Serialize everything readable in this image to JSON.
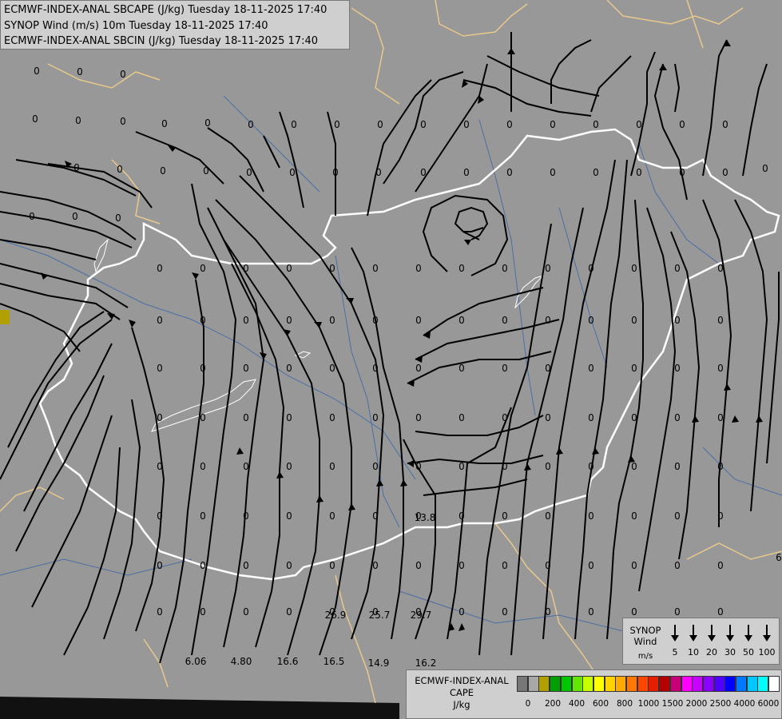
{
  "title_lines": [
    "ECMWF-INDEX-ANAL SBCAPE (J/kg) Tuesday 18-11-2025 17:40",
    "SYNOP Wind (m/s) 10m Tuesday 18-11-2025 17:40",
    "ECMWF-INDEX-ANAL SBCIN (J/kg) Tuesday 18-11-2025 17:40"
  ],
  "synop_legend": {
    "title": "SYNOP\nWind",
    "unit": "m/s",
    "speeds": [
      "5",
      "10",
      "20",
      "30",
      "50",
      "100"
    ]
  },
  "cape_legend": {
    "title": "ECMWF-INDEX-ANAL\nCAPE",
    "unit": "J/kg",
    "colors": [
      "#777777",
      "#a8a8a8",
      "#b0a000",
      "#00a000",
      "#00c800",
      "#64e600",
      "#c8ff00",
      "#ffff00",
      "#ffd200",
      "#ffaa00",
      "#ff7800",
      "#ff4600",
      "#e61e00",
      "#b40000",
      "#c80078",
      "#ff00ff",
      "#c800ff",
      "#8c00ff",
      "#5000ff",
      "#0000ff",
      "#0078ff",
      "#00c8ff",
      "#00ffff",
      "#ffffff"
    ],
    "ticks": [
      "0",
      "200",
      "400",
      "600",
      "800",
      "1000",
      "1500",
      "2000",
      "2500",
      "4000",
      "6000"
    ]
  },
  "values": [
    "0",
    "0",
    "0",
    "0",
    "0",
    "0",
    "0",
    "0",
    "0",
    "0",
    "0",
    "0",
    "0",
    "0",
    "0",
    "0",
    "0",
    "0",
    "0",
    "0",
    "0",
    "0",
    "0",
    "0",
    "0",
    "0",
    "0",
    "0",
    "0",
    "0",
    "0",
    "0",
    "0",
    "0",
    "0",
    "0",
    "0",
    "0",
    "0",
    "0",
    "13.8",
    "26.9",
    "25.7",
    "29.7",
    "6.06",
    "4.80",
    "16.6",
    "16.5",
    "14.9",
    "16.2",
    "6"
  ],
  "map": {
    "background_color": "#989898",
    "border_color": "#ffffff",
    "outer_border_color": "#e8c88c",
    "river_color": "#4a6fa5",
    "streamline_color": "#000000"
  }
}
